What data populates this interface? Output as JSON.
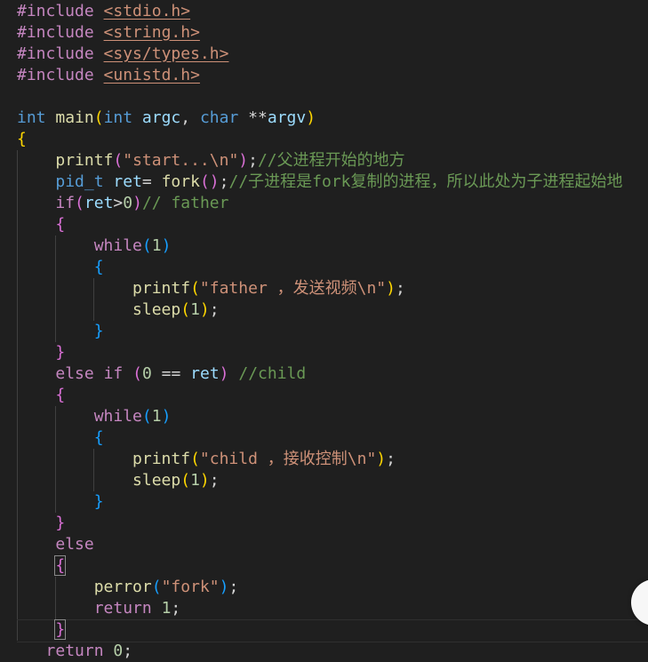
{
  "code": {
    "includes": [
      {
        "directive": "#include",
        "header": "<stdio.h>"
      },
      {
        "directive": "#include",
        "header": "<string.h>"
      },
      {
        "directive": "#include",
        "header": "<sys/types.h>"
      },
      {
        "directive": "#include",
        "header": "<unistd.h>"
      }
    ],
    "main_sig": {
      "ret_type": "int",
      "name": "main",
      "p1_type": "int",
      "p1": "argc",
      "p2_type": "char",
      "p2_ptr": "**",
      "p2": "argv"
    },
    "l7": {
      "fn": "printf",
      "str": "\"start...\\n\"",
      "comment": "//父进程开始的地方"
    },
    "l8": {
      "type": "pid_t",
      "var": "ret",
      "fn": "fork",
      "comment": "//子进程是fork复制的进程，所以此处为子进程起始地"
    },
    "l9": {
      "kw": "if",
      "var": "ret",
      "num": "0",
      "comment": "// father"
    },
    "loop_kw": "while",
    "loop_num": "1",
    "father_printf": {
      "fn": "printf",
      "str": "\"father ，发送视频\\n\""
    },
    "sleep": {
      "fn": "sleep",
      "num": "1"
    },
    "l19": {
      "kw1": "else",
      "kw2": "if",
      "num": "0",
      "op": "==",
      "var": "ret",
      "comment": "//child"
    },
    "child_printf": {
      "fn": "printf",
      "str": "\"child ，接收控制\\n\""
    },
    "else_kw": "else",
    "perror": {
      "fn": "perror",
      "str": "\"fork\""
    },
    "ret1": {
      "kw": "return",
      "num": "1"
    },
    "ret0": {
      "kw": "return",
      "num": "0"
    }
  },
  "colors": {
    "background": "#1f1f1f",
    "directive": "#c586c0",
    "string": "#ce9178",
    "type": "#569cd6",
    "function": "#dcdcaa",
    "variable": "#9cdcfe",
    "number": "#b5cea8",
    "comment": "#6a9955"
  }
}
